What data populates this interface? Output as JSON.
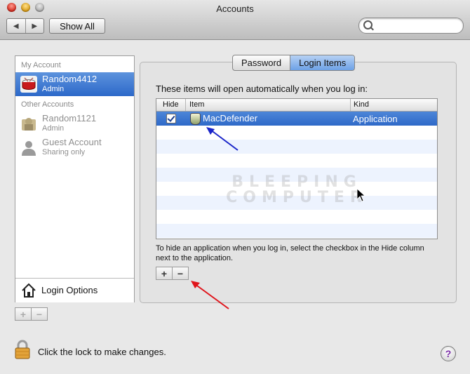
{
  "window": {
    "title": "Accounts"
  },
  "toolbar": {
    "show_all_label": "Show All",
    "back_glyph": "◀",
    "forward_glyph": "▶",
    "search_placeholder": ""
  },
  "sidebar": {
    "my_account_header": "My Account",
    "other_accounts_header": "Other Accounts",
    "accounts": [
      {
        "name": "Random4412",
        "role": "Admin",
        "selected": true
      },
      {
        "name": "Random1121",
        "role": "Admin",
        "selected": false
      },
      {
        "name": "Guest Account",
        "role": "Sharing only",
        "selected": false
      }
    ],
    "login_options_label": "Login Options",
    "add_glyph": "+",
    "remove_glyph": "−"
  },
  "tabs": [
    {
      "label": "Password",
      "active": false
    },
    {
      "label": "Login Items",
      "active": true
    }
  ],
  "login_items": {
    "instruction": "These items will open automatically when you log in:",
    "columns": [
      "Hide",
      "Item",
      "Kind"
    ],
    "rows": [
      {
        "hide": true,
        "item": "MacDefender",
        "kind": "Application"
      }
    ],
    "hint": "To hide an application when you log in, select the checkbox in the Hide column next to the application.",
    "add_glyph": "+",
    "remove_glyph": "−"
  },
  "watermark": {
    "line1": "BLEEPING",
    "line2": "COMPUTER"
  },
  "footer": {
    "lock_text": "Click the lock to make changes.",
    "help_glyph": "?"
  },
  "colors": {
    "selection": "#3c76d1",
    "annotation_blue": "#1a25c9",
    "annotation_red": "#e0141b"
  }
}
